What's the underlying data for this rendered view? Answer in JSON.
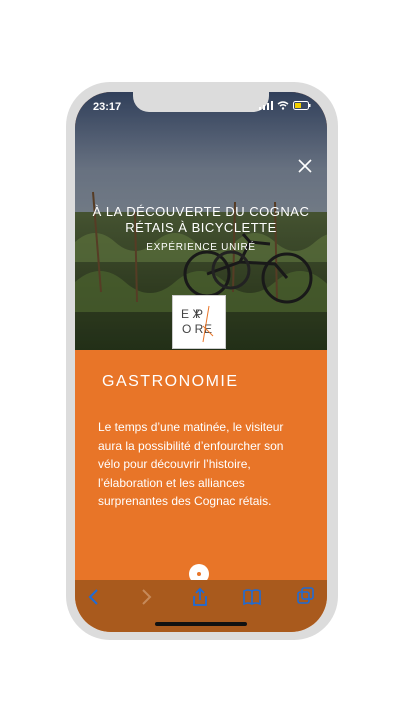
{
  "status": {
    "time": "23:17"
  },
  "hero": {
    "title_line1": "À LA DÉCOUVERTE DU COGNAC",
    "title_line2": "RÉTAIS À BICYCLETTE",
    "subtitle": "EXPÉRIENCE UNIRÉ",
    "logo_text": "EXPLORE"
  },
  "content": {
    "heading": "GASTRONOMIE",
    "description": "Le temps d’une matinée, le visiteur aura la possibilité d’enfourcher son vélo pour découvrir l’histoire, l’élaboration et les alliances surprenantes des Cognac rétais."
  },
  "colors": {
    "accent": "#e87528",
    "toolbar": "#a95a1d"
  },
  "toolbar": {
    "icons": [
      "back-icon",
      "forward-icon",
      "share-icon",
      "bookmarks-icon",
      "tabs-icon"
    ]
  }
}
